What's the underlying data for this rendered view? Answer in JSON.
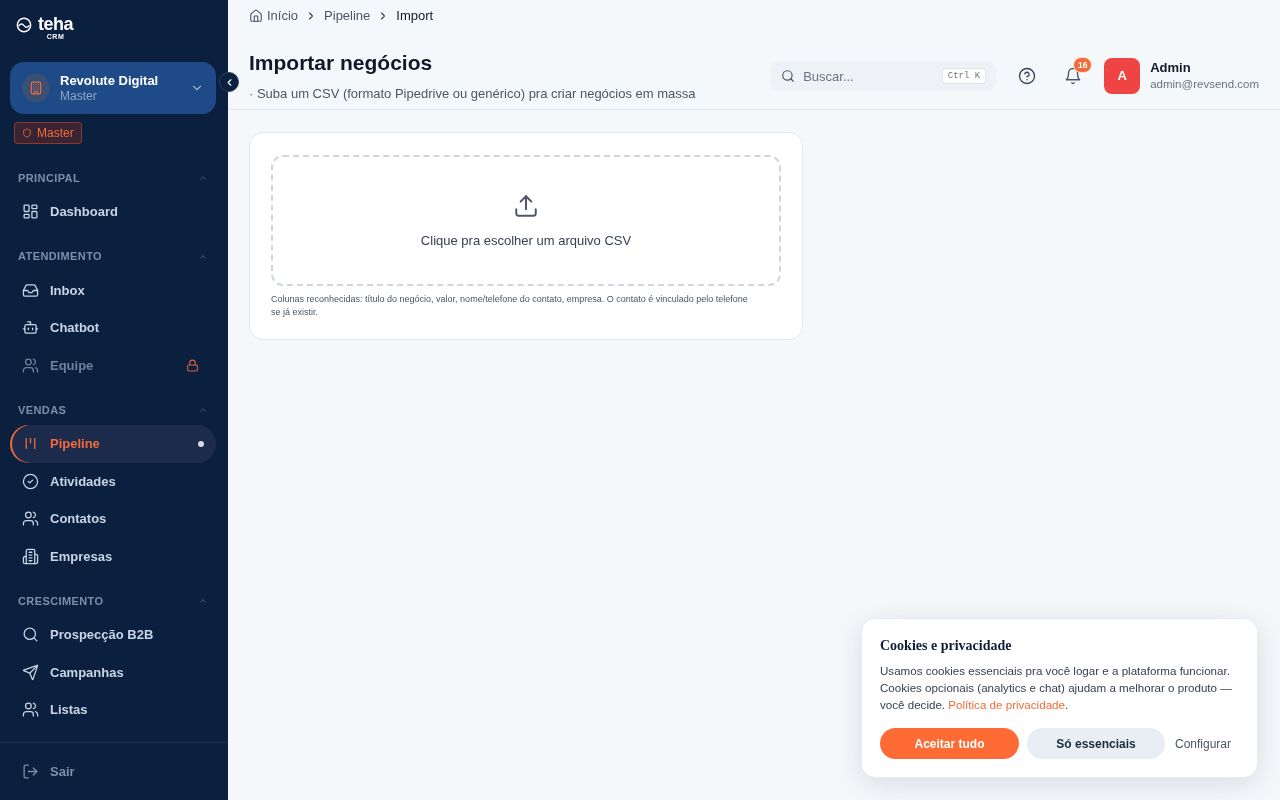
{
  "sidebar": {
    "logo": {
      "name": "teha",
      "tagline": "CRM"
    },
    "workspace": {
      "name": "Revolute Digital",
      "role": "Master"
    },
    "role_badge": "Master",
    "sections": [
      {
        "title": "PRINCIPAL",
        "expanded": true,
        "items": [
          {
            "label": "Dashboard",
            "selected": false,
            "disabled": false
          }
        ]
      },
      {
        "title": "ATENDIMENTO",
        "expanded": true,
        "items": [
          {
            "label": "Inbox",
            "selected": false,
            "disabled": false
          },
          {
            "label": "Chatbot",
            "selected": false,
            "disabled": false
          },
          {
            "label": "Equipe",
            "selected": false,
            "disabled": true
          }
        ]
      },
      {
        "title": "VENDAS",
        "expanded": true,
        "items": [
          {
            "label": "Pipeline",
            "selected": true,
            "disabled": false
          },
          {
            "label": "Atividades",
            "selected": false,
            "disabled": false
          },
          {
            "label": "Contatos",
            "selected": false,
            "disabled": false
          },
          {
            "label": "Empresas",
            "selected": false,
            "disabled": false
          }
        ]
      },
      {
        "title": "CRESCIMENTO",
        "expanded": true,
        "items": [
          {
            "label": "Prospecção B2B",
            "selected": false,
            "disabled": false
          },
          {
            "label": "Campanhas",
            "selected": false,
            "disabled": false
          },
          {
            "label": "Listas",
            "selected": false,
            "disabled": false
          }
        ]
      }
    ],
    "logout": "Sair"
  },
  "breadcrumb": [
    {
      "label": "Início",
      "current": false
    },
    {
      "label": "Pipeline",
      "current": false
    },
    {
      "label": "Import",
      "current": true
    }
  ],
  "header": {
    "title": "Importar negócios",
    "subtitle": "· Suba um CSV (formato Pipedrive ou genérico) pra criar negócios em massa"
  },
  "search": {
    "placeholder": "Buscar...",
    "shortcut": "Ctrl K"
  },
  "notifications": {
    "count": "16"
  },
  "user": {
    "initial": "A",
    "name": "Admin",
    "email": "admin@revsend.com"
  },
  "upload": {
    "prompt": "Clique pra escolher um arquivo CSV",
    "hint": "Colunas reconhecidas: título do negócio, valor, nome/telefone do contato, empresa. O contato é vinculado pelo telefone se já existir."
  },
  "cookie_banner": {
    "title": "Cookies e privacidade",
    "text": "Usamos cookies essenciais pra você logar e a plataforma funcionar. Cookies opcionais (analytics e chat) ajudam a melhorar o produto — você decide.",
    "link": "Política de privacidade",
    "text_end": ".",
    "buttons": [
      {
        "label": "Aceitar tudo",
        "kind": "primary"
      },
      {
        "label": "Só essenciais",
        "kind": "secondary"
      },
      {
        "label": "Configurar",
        "kind": "link"
      }
    ]
  }
}
